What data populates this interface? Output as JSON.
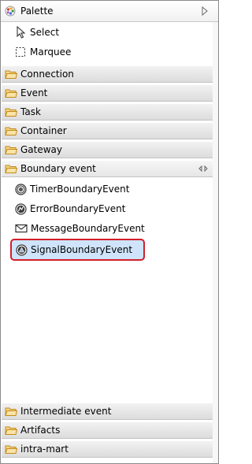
{
  "header": {
    "title": "Palette",
    "icon": "palette-icon",
    "collapse_icon": "triangle-right-icon"
  },
  "tools": [
    {
      "label": "Select",
      "icon": "arrow-pointer-icon"
    },
    {
      "label": "Marquee",
      "icon": "marquee-icon"
    }
  ],
  "drawers": {
    "connection": "Connection",
    "event": "Event",
    "task": "Task",
    "container": "Container",
    "gateway": "Gateway",
    "boundary_event": "Boundary event",
    "intermediate_event": "Intermediate event",
    "artifacts": "Artifacts",
    "intra_mart": "intra-mart"
  },
  "boundary_entries": [
    {
      "label": "TimerBoundaryEvent",
      "icon": "timer-icon"
    },
    {
      "label": "ErrorBoundaryEvent",
      "icon": "error-icon"
    },
    {
      "label": "MessageBoundaryEvent",
      "icon": "envelope-icon"
    },
    {
      "label": "SignalBoundaryEvent",
      "icon": "signal-icon",
      "selected": true
    }
  ],
  "colors": {
    "selection_border": "#d21e2a",
    "selection_fill": "#cfe4fb",
    "folder": "#e8b545"
  }
}
